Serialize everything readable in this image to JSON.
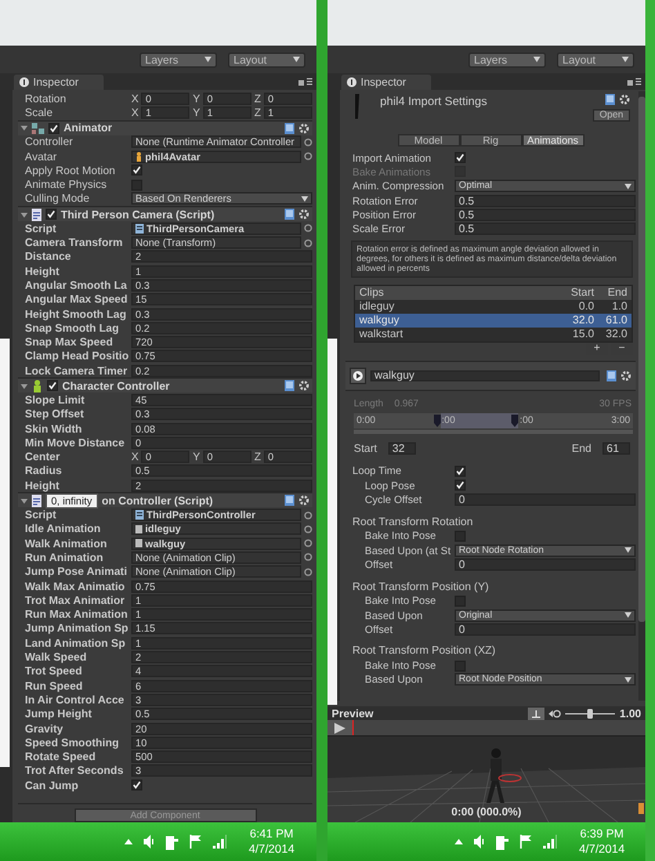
{
  "left": {
    "toolbar": [
      "Layers",
      "Layout"
    ],
    "tab": "Inspector",
    "sections": [
      {
        "overridden": false,
        "rows": [
          {
            "kind": "vector",
            "label": "Rotation",
            "values": [
              {
                "axis": "X",
                "value": "0"
              },
              {
                "axis": "Y",
                "value": "0"
              },
              {
                "axis": "Z",
                "value": "0"
              }
            ]
          },
          {
            "kind": "vector",
            "label": "Scale",
            "values": [
              {
                "axis": "X",
                "value": "1"
              },
              {
                "axis": "Y",
                "value": "1"
              },
              {
                "axis": "Z",
                "value": "1"
              }
            ]
          }
        ]
      },
      {
        "overridden": false,
        "header": {
          "enabled": true,
          "title": "Animator"
        },
        "rows": [
          {
            "kind": "object",
            "label": "Controller",
            "value": "None (Runtime Animator Controller"
          },
          {
            "kind": "avatar",
            "label": "Avatar",
            "value": "phil4Avatar"
          },
          {
            "kind": "check",
            "label": "Apply Root Motion",
            "checked": true
          },
          {
            "kind": "check",
            "label": "Animate Physics",
            "checked": false
          },
          {
            "kind": "dropdown",
            "label": "Culling Mode",
            "value": "Based On Renderers"
          }
        ]
      },
      {
        "overridden": true,
        "header": {
          "enabled": true,
          "title": "Third Person Camera (Script)"
        },
        "rows": [
          {
            "kind": "script",
            "label": "Script",
            "value": "ThirdPersonCamera"
          },
          {
            "kind": "object",
            "label": "Camera Transform",
            "value": "None (Transform)"
          },
          {
            "kind": "field",
            "label": "Distance",
            "value": "2"
          },
          {
            "kind": "field",
            "label": "Height",
            "value": "1"
          },
          {
            "kind": "field",
            "label": "Angular Smooth La",
            "value": "0.3"
          },
          {
            "kind": "field",
            "label": "Angular Max Speed",
            "value": "15"
          },
          {
            "kind": "field",
            "label": "Height Smooth Lag",
            "value": "0.3"
          },
          {
            "kind": "field",
            "label": "Snap Smooth Lag",
            "value": "0.2"
          },
          {
            "kind": "field",
            "label": "Snap Max Speed",
            "value": "720"
          },
          {
            "kind": "field",
            "label": "Clamp Head Positio",
            "value": "0.75"
          },
          {
            "kind": "field",
            "label": "Lock Camera Timer",
            "value": "0.2"
          }
        ]
      },
      {
        "overridden": true,
        "header": {
          "enabled": true,
          "title": "Character Controller"
        },
        "rows": [
          {
            "kind": "field",
            "label": "Slope Limit",
            "value": "45"
          },
          {
            "kind": "field",
            "label": "Step Offset",
            "value": "0.3"
          },
          {
            "kind": "field",
            "label": "Skin Width",
            "value": "0.08"
          },
          {
            "kind": "field",
            "label": "Min Move Distance",
            "value": "0"
          },
          {
            "kind": "vector",
            "label": "Center",
            "values": [
              {
                "axis": "X",
                "value": "0"
              },
              {
                "axis": "Y",
                "value": "0"
              },
              {
                "axis": "Z",
                "value": "0"
              }
            ]
          },
          {
            "kind": "field",
            "label": "Radius",
            "value": "0.5"
          },
          {
            "kind": "field",
            "label": "Height",
            "value": "2"
          }
        ]
      },
      {
        "overridden": true,
        "header": {
          "tooltip": "0, infinity",
          "title": "on Controller (Script)"
        },
        "rows": [
          {
            "kind": "script",
            "label": "Script",
            "value": "ThirdPersonController"
          },
          {
            "kind": "clip",
            "label": "Idle Animation",
            "value": "idleguy"
          },
          {
            "kind": "clip",
            "label": "Walk Animation",
            "value": "walkguy"
          },
          {
            "kind": "object",
            "label": "Run Animation",
            "value": "None (Animation Clip)"
          },
          {
            "kind": "object",
            "label": "Jump Pose Animati",
            "value": "None (Animation Clip)"
          },
          {
            "kind": "field",
            "label": "Walk Max Animatio",
            "value": "0.75"
          },
          {
            "kind": "field",
            "label": "Trot Max Animatior",
            "value": "1"
          },
          {
            "kind": "field",
            "label": "Run Max Animation",
            "value": "1"
          },
          {
            "kind": "field",
            "label": "Jump Animation Sp",
            "value": "1.15"
          },
          {
            "kind": "field",
            "label": "Land Animation Sp",
            "value": "1"
          },
          {
            "kind": "field",
            "label": "Walk Speed",
            "value": "2"
          },
          {
            "kind": "field",
            "label": "Trot Speed",
            "value": "4"
          },
          {
            "kind": "field",
            "label": "Run Speed",
            "value": "6"
          },
          {
            "kind": "field",
            "label": "In Air Control Acce",
            "value": "3"
          },
          {
            "kind": "field",
            "label": "Jump Height",
            "value": "0.5"
          },
          {
            "kind": "field",
            "label": "Gravity",
            "value": "20"
          },
          {
            "kind": "field",
            "label": "Speed Smoothing",
            "value": "10"
          },
          {
            "kind": "field",
            "label": "Rotate Speed",
            "value": "500"
          },
          {
            "kind": "field",
            "label": "Trot After Seconds",
            "value": "3"
          },
          {
            "kind": "check",
            "label": "Can Jump",
            "checked": true
          }
        ]
      }
    ],
    "add_component": "Add Component",
    "taskbar": {
      "time": "6:41 PM",
      "date": "4/7/2014"
    }
  },
  "right": {
    "toolbar": [
      "Layers",
      "Layout"
    ],
    "tab": "Inspector",
    "asset": {
      "title": "phil4 Import Settings",
      "open": "Open"
    },
    "tabs": [
      {
        "label": "Model",
        "selected": false
      },
      {
        "label": "Rig",
        "selected": false
      },
      {
        "label": "Animations",
        "selected": true
      }
    ],
    "rows": [
      {
        "kind": "check",
        "label": "Import Animation",
        "checked": true,
        "disabled": false
      },
      {
        "kind": "check",
        "label": "Bake Animations",
        "checked": false,
        "disabled": true
      },
      {
        "kind": "dropdown",
        "label": "Anim. Compression",
        "value": "Optimal",
        "disabled": false
      },
      {
        "kind": "field",
        "label": "Rotation Error",
        "value": "0.5",
        "disabled": false
      },
      {
        "kind": "field",
        "label": "Position Error",
        "value": "0.5",
        "disabled": false
      },
      {
        "kind": "field",
        "label": "Scale Error",
        "value": "0.5",
        "disabled": false
      }
    ],
    "help": "Rotation error is defined as maximum angle deviation allowed in degrees, for others it is defined as maximum distance/delta deviation allowed in percents",
    "clips": {
      "columns": [
        "Clips",
        "Start",
        "End"
      ],
      "rows": [
        {
          "name": "idleguy",
          "start": "0.0",
          "end": "1.0",
          "selected": false
        },
        {
          "name": "walkguy",
          "start": "32.0",
          "end": "61.0",
          "selected": true
        },
        {
          "name": "walkstart",
          "start": "15.0",
          "end": "32.0",
          "selected": false
        }
      ],
      "buttons": [
        "+",
        "−"
      ]
    },
    "clip_name": "walkguy",
    "timeline": {
      "length_label": "Length",
      "length": "0.967",
      "fps": "30 FPS",
      "ticks": [
        "0:00",
        ":00",
        ":00",
        "3:00"
      ],
      "markers": [
        {
          "level": 0.31
        },
        {
          "level": 0.59
        }
      ]
    },
    "range": {
      "start_label": "Start",
      "start": "32",
      "end_label": "End",
      "end": "61"
    },
    "loop": [
      {
        "kind": "check",
        "label": "Loop Time",
        "checked": true,
        "children": [
          {
            "kind": "check",
            "label": "Loop Pose",
            "checked": true
          },
          {
            "kind": "field",
            "label": "Cycle Offset",
            "value": "0"
          }
        ]
      }
    ],
    "groups": [
      {
        "title": "Root Transform Rotation",
        "rows": [
          {
            "kind": "check",
            "label": "Bake Into Pose",
            "checked": false
          },
          {
            "kind": "dropdown",
            "label": "Based Upon (at St",
            "value": "Root Node Rotation"
          },
          {
            "kind": "field",
            "label": "Offset",
            "value": "0"
          }
        ]
      },
      {
        "title": "Root Transform Position (Y)",
        "rows": [
          {
            "kind": "check",
            "label": "Bake Into Pose",
            "checked": false
          },
          {
            "kind": "dropdown",
            "label": "Based Upon",
            "value": "Original"
          },
          {
            "kind": "field",
            "label": "Offset",
            "value": "0"
          }
        ]
      },
      {
        "title": "Root Transform Position (XZ)",
        "rows": [
          {
            "kind": "check",
            "label": "Bake Into Pose",
            "checked": false
          },
          {
            "kind": "dropdown",
            "label": "Based Upon",
            "value": "Root Node Position"
          }
        ]
      }
    ],
    "preview": {
      "title": "Preview",
      "speed": "1.00",
      "level": 0.5,
      "time": "0:00 (000.0%)"
    },
    "taskbar": {
      "time": "6:39 PM",
      "date": "4/7/2014"
    }
  }
}
